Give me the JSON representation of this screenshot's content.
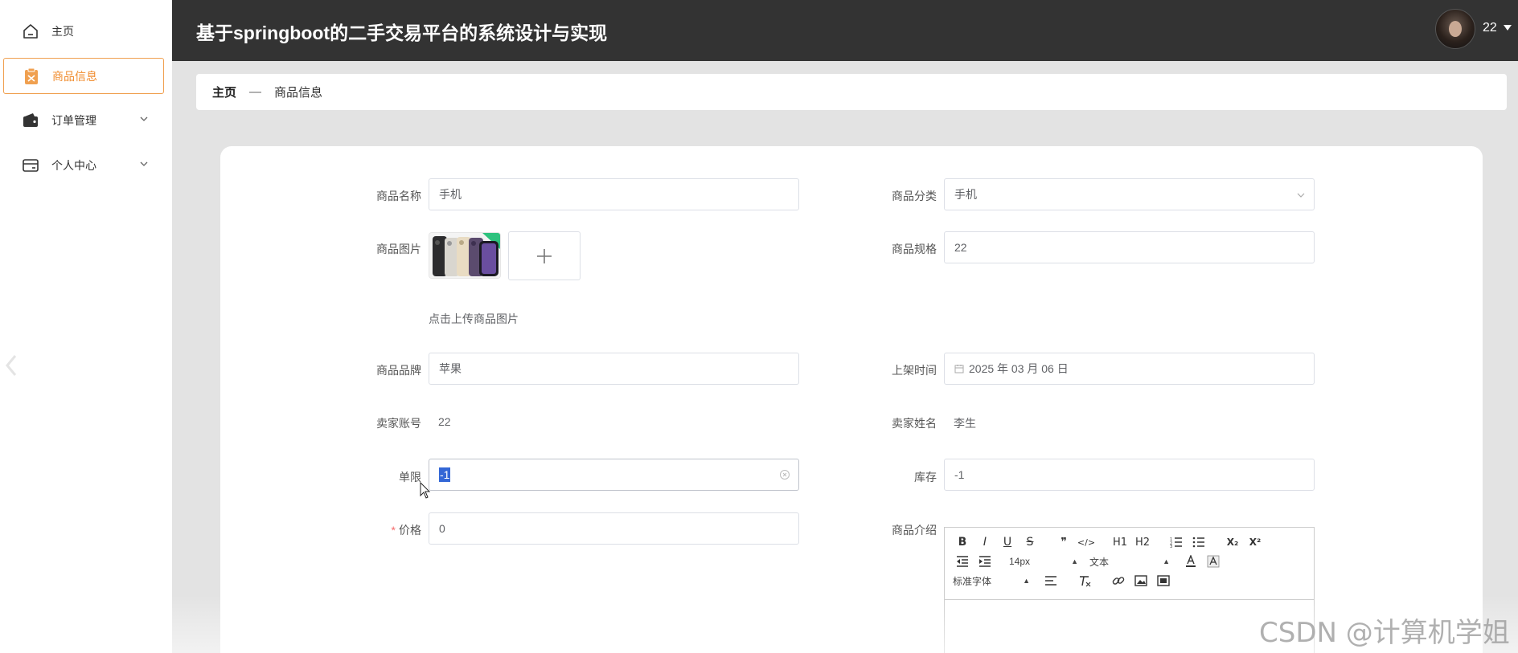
{
  "app": {
    "title": "基于springboot的二手交易平台的系统设计与实现",
    "user_name": "22"
  },
  "sidebar": {
    "items": [
      {
        "label": "主页",
        "icon": "home-icon"
      },
      {
        "label": "商品信息",
        "icon": "goods-icon",
        "active": true
      },
      {
        "label": "订单管理",
        "icon": "wallet-icon",
        "has_submenu": true
      },
      {
        "label": "个人中心",
        "icon": "card-icon",
        "has_submenu": true
      }
    ]
  },
  "breadcrumb": {
    "home": "主页",
    "separator": "—",
    "current": "商品信息"
  },
  "form": {
    "name_label": "商品名称",
    "name_value": "手机",
    "category_label": "商品分类",
    "category_value": "手机",
    "image_label": "商品图片",
    "image_hint": "点击上传商品图片",
    "spec_label": "商品规格",
    "spec_value": "22",
    "brand_label": "商品品牌",
    "brand_value": "苹果",
    "shelf_time_label": "上架时间",
    "shelf_time_value": "2025 年 03 月 06 日",
    "seller_account_label": "卖家账号",
    "seller_account_value": "22",
    "seller_name_label": "卖家姓名",
    "seller_name_value": "李生",
    "limit_label": "单限",
    "limit_value": "-1",
    "stock_label": "库存",
    "stock_value": "-1",
    "price_required_mark": "*",
    "price_label": "价格",
    "price_value": "0",
    "intro_label": "商品介绍"
  },
  "editor": {
    "row1": [
      "B",
      "I",
      "U",
      "S",
      "❞",
      "</>",
      "H1",
      "H2",
      "ol",
      "ul",
      "X₂",
      "X²"
    ],
    "font_size": "14px",
    "text_type": "文本",
    "font_family": "标准字体"
  },
  "watermark": "CSDN @计算机学姐",
  "colors": {
    "header_bg": "#333333",
    "accent": "#f08c2e",
    "page_bg": "#e3e3e3",
    "required": "#f56c6c"
  }
}
